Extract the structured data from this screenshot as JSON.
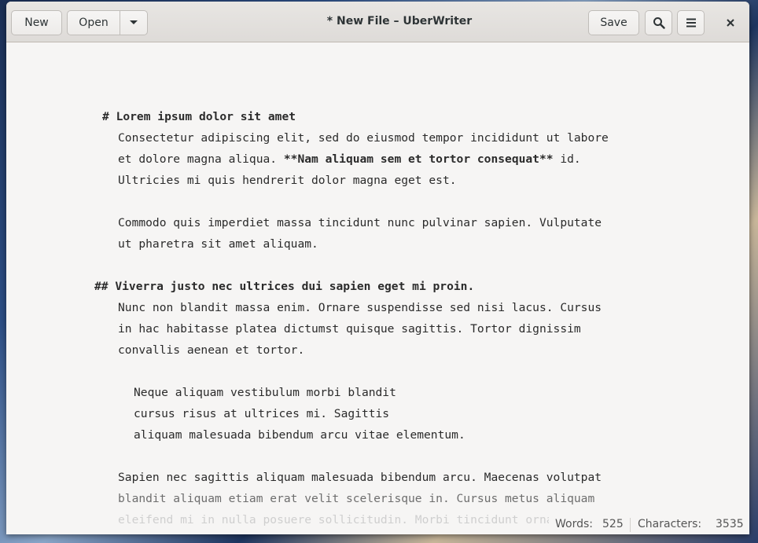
{
  "window": {
    "title": "* New File  –  UberWriter"
  },
  "toolbar": {
    "new_label": "New",
    "open_label": "Open",
    "open_menu_icon": "chevron-down-icon",
    "save_label": "Save",
    "search_icon": "search-icon",
    "menu_icon": "hamburger-menu-icon",
    "close_icon": "close-icon"
  },
  "document": {
    "heading1": "# Lorem ipsum dolor sit amet",
    "p1_line1": "Consectetur adipiscing elit, sed do eiusmod tempor incididunt ut labore",
    "p1_line2_a": "et dolore magna aliqua. ",
    "p1_line2_bold": "**Nam aliquam sem et tortor consequat**",
    "p1_line2_b": " id.",
    "p1_line3": "Ultricies mi quis hendrerit dolor magna eget est.",
    "p2_line1": "Commodo quis imperdiet massa tincidunt nunc pulvinar sapien. Vulputate",
    "p2_line2": "ut pharetra sit amet aliquam.",
    "heading2": "## Viverra justo nec ultrices dui sapien eget mi proin.",
    "p3_line1": "Nunc non blandit massa enim. Ornare suspendisse sed nisi lacus. Cursus",
    "p3_line2": "in hac habitasse platea dictumst quisque sagittis. Tortor dignissim",
    "p3_line3": "convallis aenean et tortor.",
    "q_line1": "Neque aliquam vestibulum morbi blandit",
    "q_line2": "cursus risus at ultrices mi. Sagittis",
    "q_line3": "aliquam malesuada bibendum arcu vitae elementum.",
    "p4_line1": "Sapien nec sagittis aliquam malesuada bibendum arcu. Maecenas volutpat",
    "p4_line2": "blandit aliquam etiam erat velit scelerisque in. Cursus metus aliquam",
    "p4_line3": "eleifend mi in nulla posuere sollicitudin. Morbi tincidunt ornare massa"
  },
  "status": {
    "words_label": "Words:",
    "words_value": "525",
    "chars_label": "Characters:",
    "chars_value": "3535"
  }
}
